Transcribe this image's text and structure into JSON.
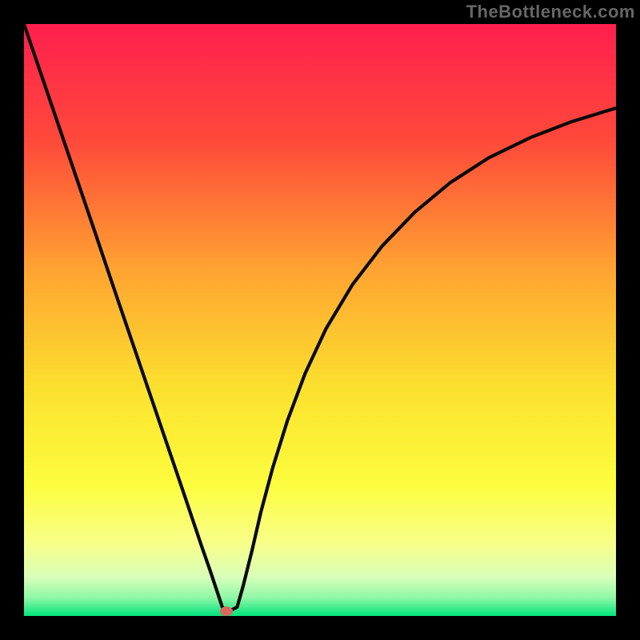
{
  "watermark": "TheBottleneck.com",
  "gradient_stops": [
    {
      "offset": 0,
      "color": "#ff1f4e"
    },
    {
      "offset": 0.2,
      "color": "#ff4a3a"
    },
    {
      "offset": 0.42,
      "color": "#ffa531"
    },
    {
      "offset": 0.62,
      "color": "#fbe22e"
    },
    {
      "offset": 0.78,
      "color": "#fdfd3f"
    },
    {
      "offset": 0.88,
      "color": "#f7ff8c"
    },
    {
      "offset": 0.935,
      "color": "#d8ffb9"
    },
    {
      "offset": 0.97,
      "color": "#8cf7a6"
    },
    {
      "offset": 1.0,
      "color": "#00e47a"
    }
  ],
  "marker": {
    "x_frac": 0.342,
    "y_frac": 0.992,
    "color": "#d86a5e"
  },
  "chart_data": {
    "type": "line",
    "title": "",
    "xlabel": "",
    "ylabel": "",
    "xlim": [
      0,
      1
    ],
    "ylim": [
      0,
      1
    ],
    "grid": false,
    "series": [
      {
        "name": "left-branch",
        "x": [
          0.0,
          0.03,
          0.06,
          0.09,
          0.12,
          0.15,
          0.18,
          0.21,
          0.24,
          0.27,
          0.3,
          0.315,
          0.325,
          0.33,
          0.335
        ],
        "y": [
          1.0,
          0.912,
          0.824,
          0.736,
          0.648,
          0.559,
          0.471,
          0.383,
          0.295,
          0.207,
          0.118,
          0.075,
          0.045,
          0.03,
          0.015
        ]
      },
      {
        "name": "flat-bottom",
        "x": [
          0.335,
          0.34,
          0.35,
          0.36
        ],
        "y": [
          0.015,
          0.01,
          0.01,
          0.015
        ]
      },
      {
        "name": "right-branch",
        "x": [
          0.36,
          0.37,
          0.385,
          0.4,
          0.42,
          0.445,
          0.475,
          0.51,
          0.555,
          0.605,
          0.66,
          0.72,
          0.785,
          0.855,
          0.925,
          1.0
        ],
        "y": [
          0.015,
          0.05,
          0.11,
          0.175,
          0.25,
          0.33,
          0.41,
          0.485,
          0.56,
          0.625,
          0.682,
          0.732,
          0.774,
          0.808,
          0.835,
          0.858
        ]
      }
    ],
    "marker_point": {
      "x": 0.342,
      "y": 0.008
    }
  }
}
